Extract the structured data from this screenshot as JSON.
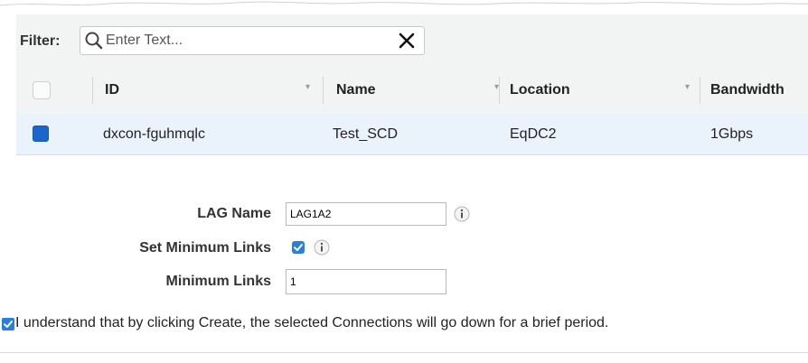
{
  "filter": {
    "label": "Filter:",
    "placeholder": "Enter Text...",
    "value": ""
  },
  "table": {
    "columns": [
      "ID",
      "Name",
      "Location",
      "Bandwidth"
    ],
    "rows": [
      {
        "selected": true,
        "id": "dxcon-fguhmqlc",
        "name": "Test_SCD",
        "location": "EqDC2",
        "bandwidth": "1Gbps"
      }
    ]
  },
  "form": {
    "lag_name_label": "LAG Name",
    "lag_name_value": "LAG1A2",
    "set_min_links_label": "Set Minimum Links",
    "set_min_links_checked": true,
    "min_links_label": "Minimum Links",
    "min_links_value": "1"
  },
  "acknowledge": {
    "checked": true,
    "text": "I understand that by clicking Create, the selected Connections will go down for a brief period."
  },
  "colors": {
    "accent": "#1b66c9",
    "selected_row": "#eaf2fb",
    "header_bg": "#f2f3f3"
  }
}
